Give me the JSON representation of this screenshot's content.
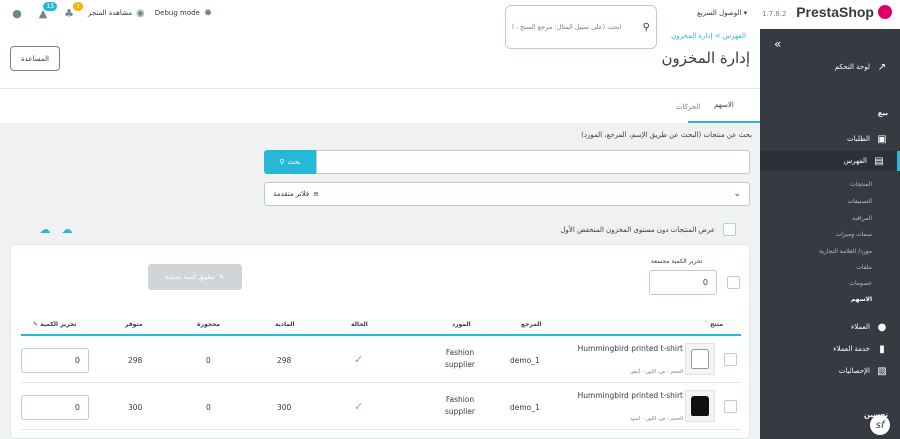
{
  "header": {
    "logo": "PrestaShop",
    "version": "1.7.8.2",
    "quick_access": "الوصول السريع ▾",
    "search_placeholder": "ابحث (على سبيل المثال: مرجع المنتج ، ا",
    "debug_mode": "Debug mode",
    "view_store": "مشاهدة المتجر",
    "badge_orders": "13",
    "badge_notifications": "1"
  },
  "breadcrumb": "الفهرس  >  إدارة المخزون",
  "page_title": "إدارة المخزون",
  "help_button": "المساعدة",
  "tabs": [
    {
      "label": "الاسهم",
      "active": true
    },
    {
      "label": "الحركات",
      "active": false
    }
  ],
  "search": {
    "label": "بحث عن منتجات (البحث عن طريق الإسم، المرجع، المورد)",
    "button": "بحث",
    "value": ""
  },
  "filters": {
    "label": "فلاتر متقدمة"
  },
  "low_stock_label": "عرض المنتجات دون مستوى المخزون المنخفض الأول",
  "bulk": {
    "label": "تحرير الكمية مجتمعة",
    "value": "0",
    "apply_button": "تطبيق كمية جديدة"
  },
  "table": {
    "columns": {
      "product": "منتج",
      "reference": "المرجع",
      "supplier": "المورد",
      "status": "الحالة",
      "physical": "المادية",
      "reserved": "محجوزة",
      "available": "متوفر",
      "edit_quantity": "تحرير الكمية"
    },
    "rows": [
      {
        "name": "Hummingbird printed t-shirt",
        "attributes": "الحجم - ص، اللون - أبيض",
        "reference": "demo_1",
        "supplier": "Fashion supplier",
        "physical": "298",
        "reserved": "0",
        "available": "298",
        "edit_qty": "0",
        "tee_color": "#ffffff"
      },
      {
        "name": "Hummingbird printed t-shirt",
        "attributes": "الحجم - ص، اللون - اسود",
        "reference": "demo_1",
        "supplier": "Fashion supplier",
        "physical": "300",
        "reserved": "0",
        "available": "300",
        "edit_qty": "0",
        "tee_color": "#111111"
      }
    ]
  },
  "sidebar": {
    "dashboard": "لوحة التحكم",
    "sell_section": "بيع",
    "orders": "الطلبات",
    "catalog": "الفهرس",
    "catalog_items": [
      "المنتجات",
      "التصنيفات",
      "المراقبة",
      "سمات وميزات",
      "مورد/ العلامة التجارية",
      "ملفات",
      "خصومات",
      "الاسهم"
    ],
    "customers": "العملاء",
    "customer_service": "خدمة العملاء",
    "stats": "الإحصائيات",
    "improve_section": "تحسين"
  },
  "colors": {
    "accent": "#25b9d7",
    "sidebar_bg": "#363a41",
    "logo_pink": "#df0067",
    "success": "#70b580"
  }
}
